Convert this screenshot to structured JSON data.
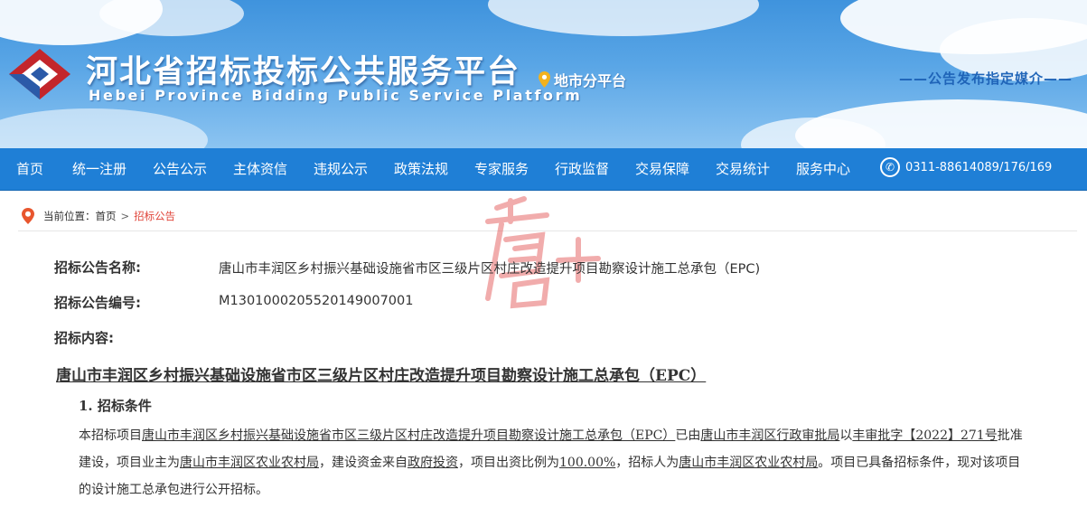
{
  "header": {
    "title": "河北省招标投标公共服务平台",
    "subtitle": "Hebei Province Bidding Public Service Platform",
    "city_link": "地市分平台",
    "media_tag": "——公告发布指定媒介——"
  },
  "nav": {
    "items": [
      "首页",
      "统一注册",
      "公告公示",
      "主体资信",
      "违规公示",
      "政策法规",
      "专家服务",
      "行政监督",
      "交易保障",
      "交易统计",
      "服务中心"
    ],
    "phone": "0311-88614089/176/169"
  },
  "breadcrumb": {
    "prefix": "当前位置：",
    "home": "首页",
    "separator": ">",
    "current": "招标公告"
  },
  "notice": {
    "name_label": "招标公告名称:",
    "name_value": "唐山市丰润区乡村振兴基础设施省市区三级片区村庄改造提升项目勘察设计施工总承包（EPC)",
    "code_label": "招标公告编号:",
    "code_value": "M1301000205520149007001",
    "content_label": "招标内容:",
    "doc_title": "唐山市丰润区乡村振兴基础设施省市区三级片区村庄改造提升项目勘察设计施工总承包（EPC）",
    "section_title": "1.  招标条件",
    "para": {
      "t1": "本招标项目",
      "u1": "唐山市丰润区乡村振兴基础设施省市区三级片区村庄改造提升项目勘察设计施工总承包（EPC）",
      "t2": "已由",
      "u2": "唐山市丰润区行政审批局",
      "t3": "以",
      "u3": "丰审批字【2022】271号",
      "t4": "批准建设，项目业主为",
      "u4": "唐山市丰润区农业农村局",
      "t5": "，建设资金来自",
      "u5": "政府投资",
      "t6": "，项目出资比例为",
      "u6": "100.00%",
      "t7": "，招标人为",
      "u7": "唐山市丰润区农业农村局",
      "t8": "。项目已具备招标条件，现对该项目的设计施工总承包进行公开招标。"
    }
  },
  "colors": {
    "nav_bg": "#1f7fd6",
    "accent_red": "#e0453a",
    "media_tag": "#1f64b8"
  }
}
